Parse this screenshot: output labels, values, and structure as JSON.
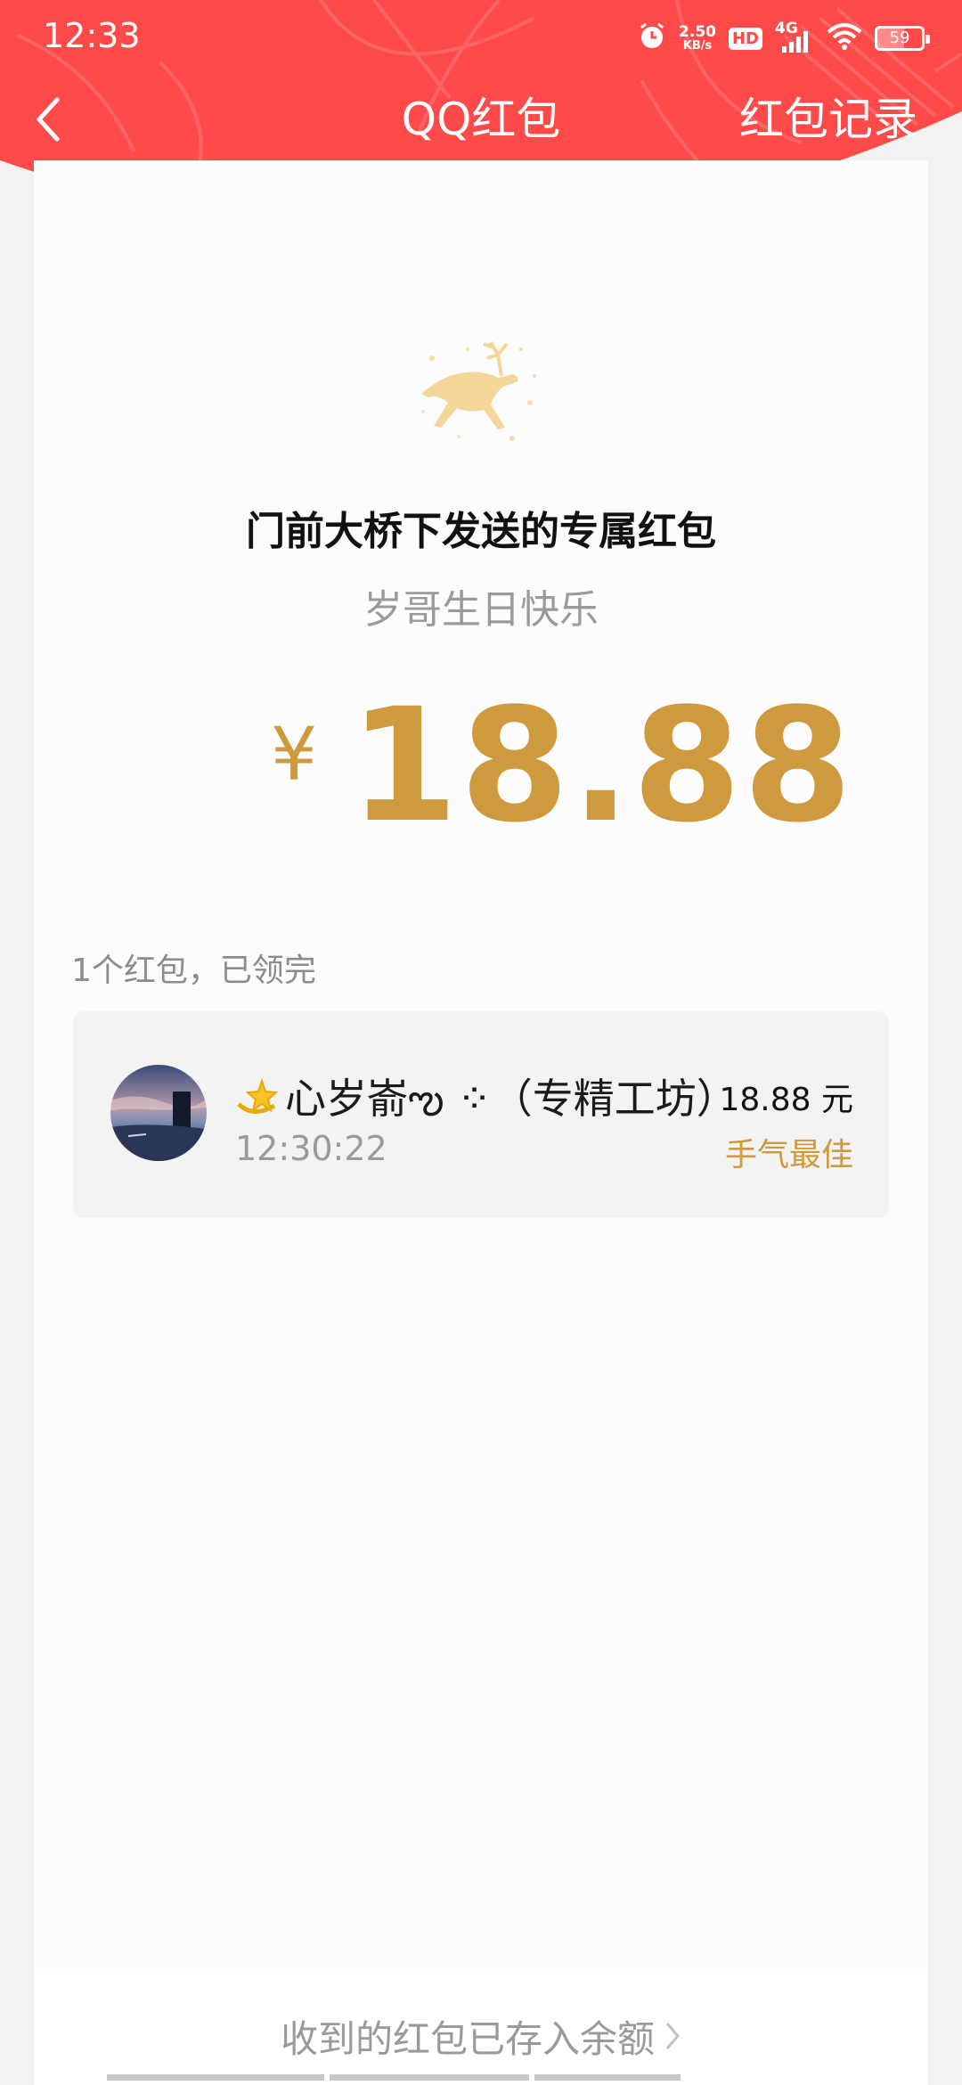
{
  "status_bar": {
    "time": "12:33",
    "net_speed_value": "2.50",
    "net_speed_unit": "KB/s",
    "hd_label": "HD",
    "network_label": "4G",
    "battery_level": "59"
  },
  "nav": {
    "title": "QQ红包",
    "records_label": "红包记录"
  },
  "packet": {
    "sender_title": "门前大桥下发送的专属红包",
    "greeting": "岁哥生日快乐",
    "currency_symbol": "¥",
    "amount": "18.88"
  },
  "summary": {
    "text": "1个红包，已领完"
  },
  "records": [
    {
      "name": "心岁嵛ఌ︎ ⁘（专精工坊）",
      "time": "12:30:22",
      "amount": "18.88 元",
      "badge": "手气最佳"
    }
  ],
  "footer": {
    "link_label": "收到的红包已存入余额"
  },
  "colors": {
    "header_red": "#ff4a4a",
    "gold": "#cd9a3e"
  }
}
